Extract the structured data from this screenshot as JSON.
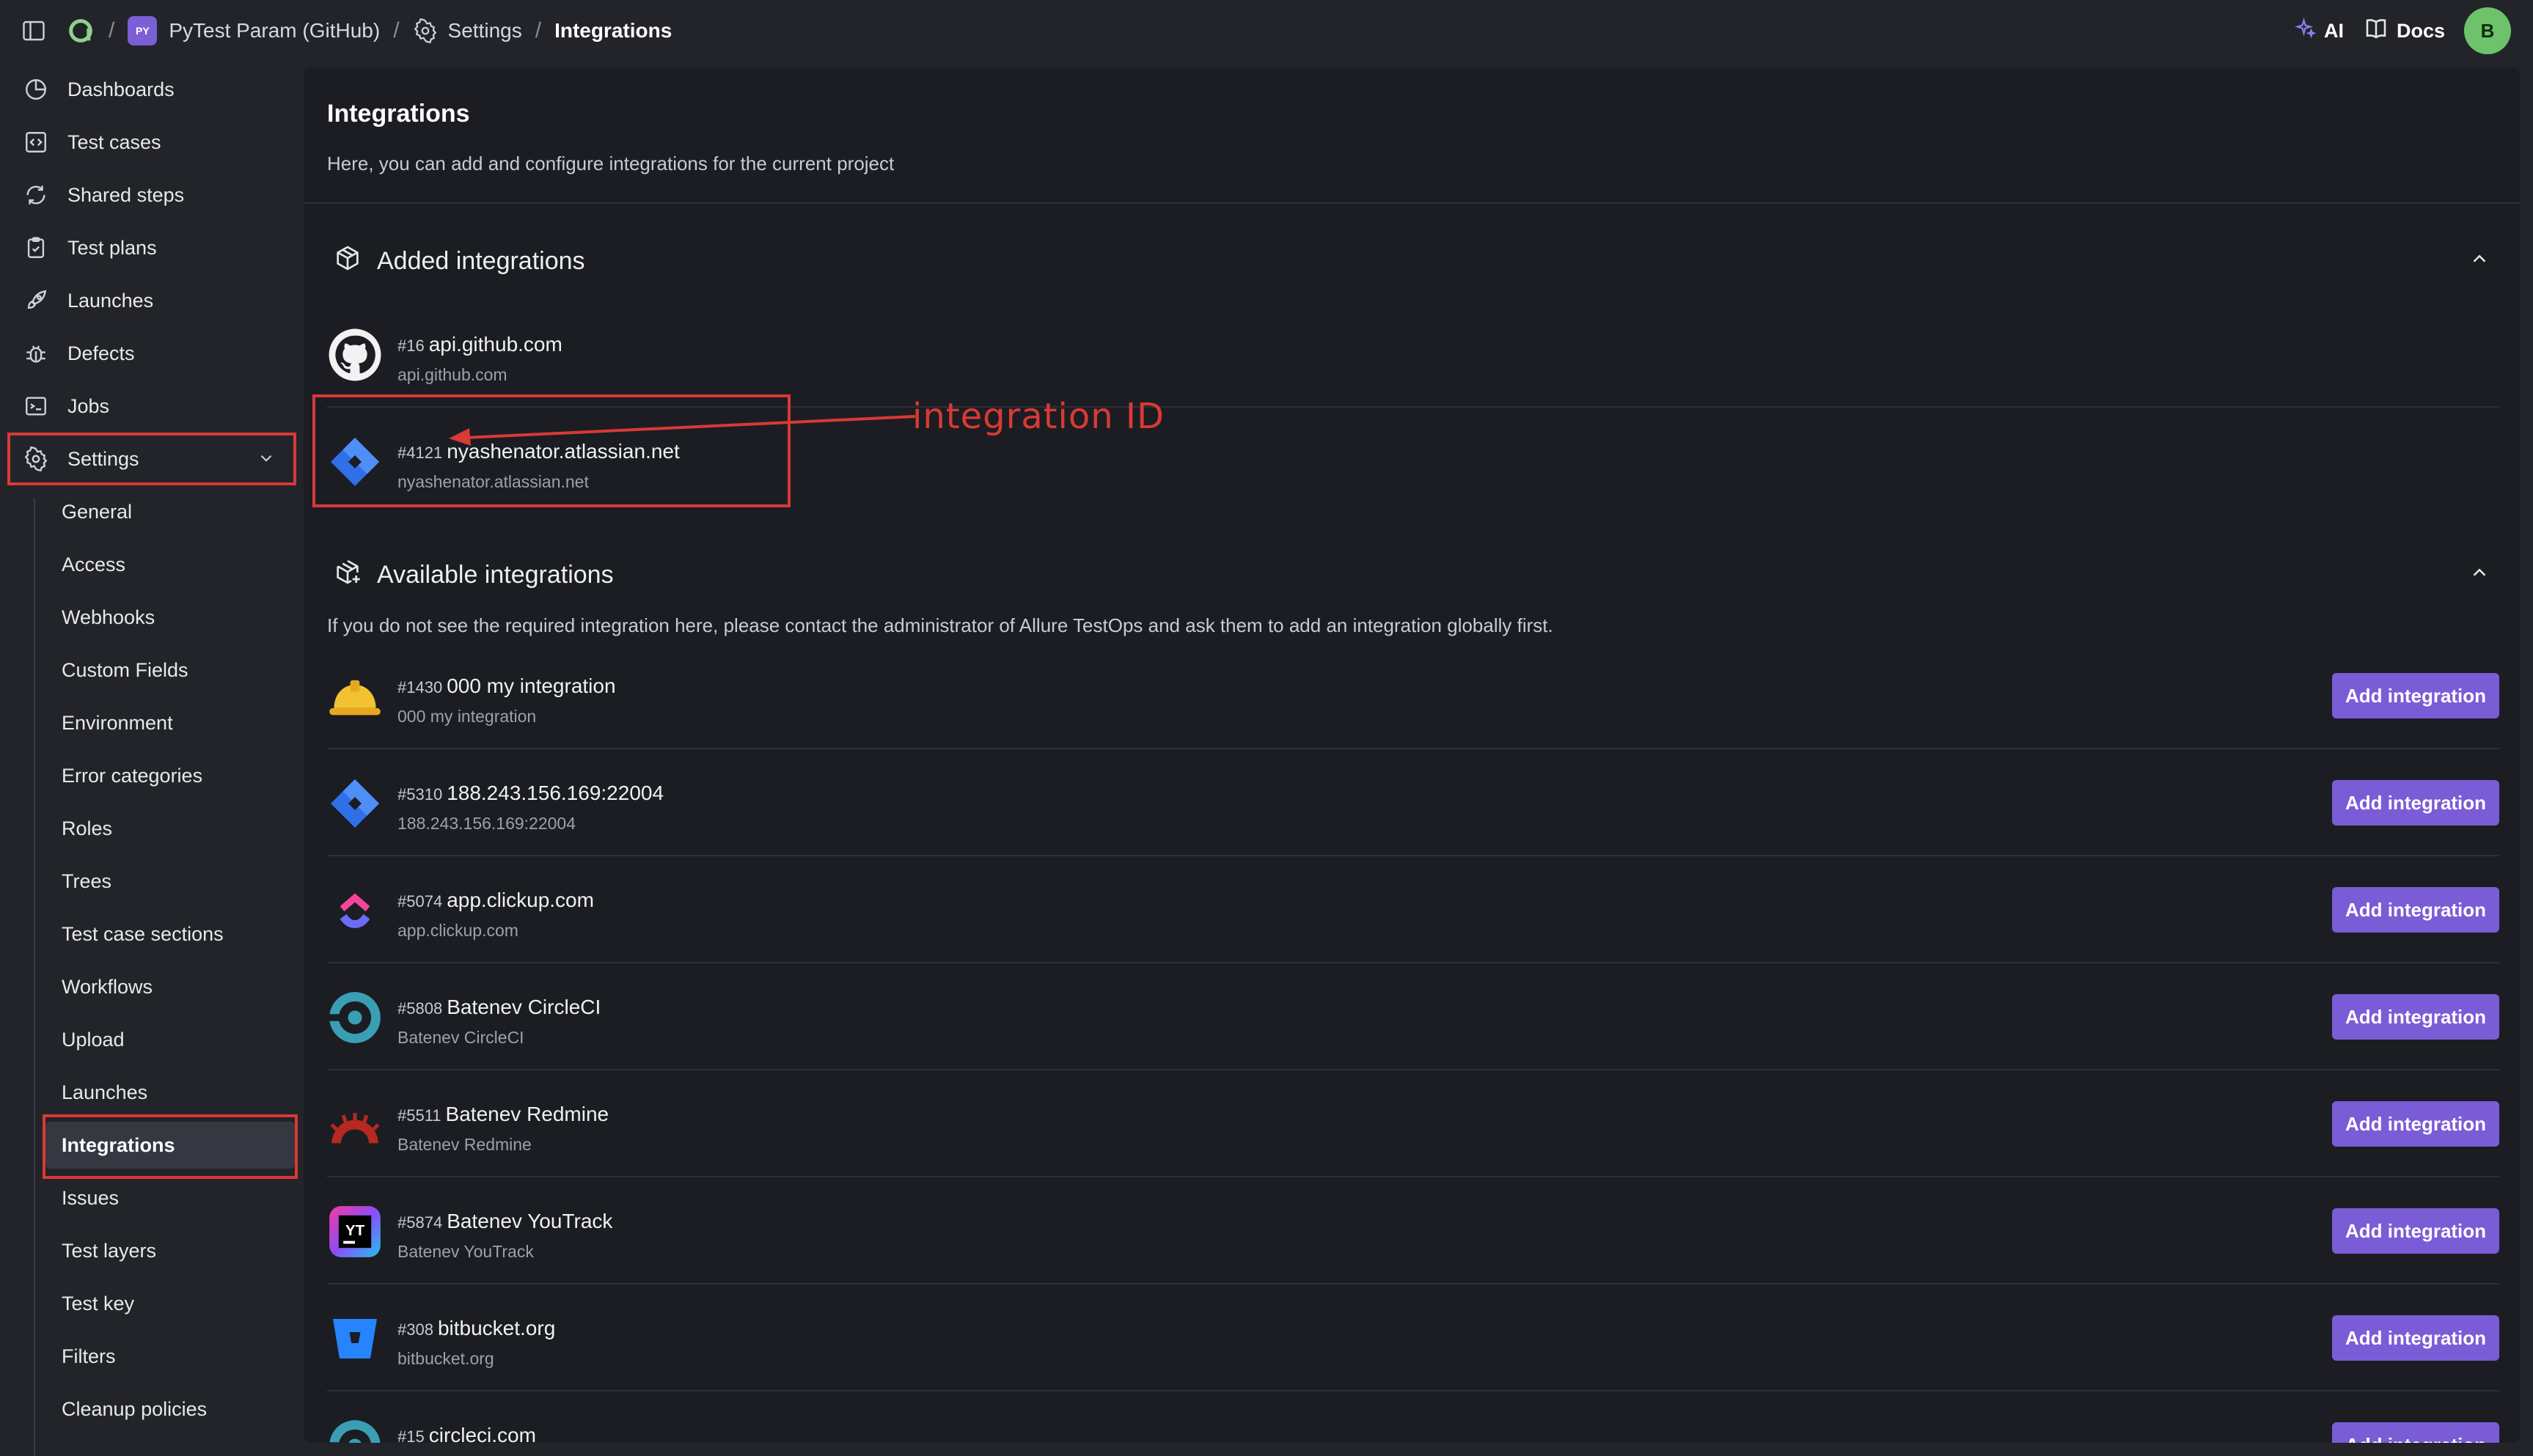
{
  "topbar": {
    "separator": "/",
    "project_badge": "PY",
    "project_name": "PyTest Param (GitHub)",
    "crumb_settings": "Settings",
    "crumb_current": "Integrations",
    "ai_label": "AI",
    "docs_label": "Docs",
    "avatar_initial": "B"
  },
  "sidebar": {
    "items": [
      {
        "label": "Dashboards",
        "icon": "dashboard-icon"
      },
      {
        "label": "Test cases",
        "icon": "code-icon"
      },
      {
        "label": "Shared steps",
        "icon": "refresh-icon"
      },
      {
        "label": "Test plans",
        "icon": "clipboard-icon"
      },
      {
        "label": "Launches",
        "icon": "rocket-icon"
      },
      {
        "label": "Defects",
        "icon": "bug-icon"
      },
      {
        "label": "Jobs",
        "icon": "terminal-icon"
      },
      {
        "label": "Settings",
        "icon": "gear-icon"
      }
    ],
    "settings_sub": [
      "General",
      "Access",
      "Webhooks",
      "Custom Fields",
      "Environment",
      "Error categories",
      "Roles",
      "Trees",
      "Test case sections",
      "Workflows",
      "Upload",
      "Launches",
      "Integrations",
      "Issues",
      "Test layers",
      "Test key",
      "Filters",
      "Cleanup policies"
    ],
    "active_sub": "Integrations"
  },
  "main": {
    "title": "Integrations",
    "description": "Here, you can add and configure integrations for the current project",
    "added": {
      "heading": "Added integrations",
      "items": [
        {
          "id": "#16",
          "name": "api.github.com",
          "sub": "api.github.com",
          "icon": "github-icon"
        },
        {
          "id": "#4121",
          "name": "nyashenator.atlassian.net",
          "sub": "nyashenator.atlassian.net",
          "icon": "jira-icon"
        }
      ]
    },
    "available": {
      "heading": "Available integrations",
      "note": "If you do not see the required integration here, please contact the administrator of Allure TestOps and ask them to add an integration globally first.",
      "button_label": "Add integration",
      "items": [
        {
          "id": "#1430",
          "name": "000 my integration",
          "sub": "000 my integration",
          "icon": "hardhat-icon"
        },
        {
          "id": "#5310",
          "name": "188.243.156.169:22004",
          "sub": "188.243.156.169:22004",
          "icon": "jira-icon"
        },
        {
          "id": "#5074",
          "name": "app.clickup.com",
          "sub": "app.clickup.com",
          "icon": "clickup-icon"
        },
        {
          "id": "#5808",
          "name": "Batenev CircleCI",
          "sub": "Batenev CircleCI",
          "icon": "circleci-icon"
        },
        {
          "id": "#5511",
          "name": "Batenev Redmine",
          "sub": "Batenev Redmine",
          "icon": "redmine-icon"
        },
        {
          "id": "#5874",
          "name": "Batenev YouTrack",
          "sub": "Batenev YouTrack",
          "icon": "youtrack-icon"
        },
        {
          "id": "#308",
          "name": "bitbucket.org",
          "sub": "bitbucket.org",
          "icon": "bitbucket-icon"
        },
        {
          "id": "#15",
          "name": "circleci.com",
          "sub": "",
          "icon": "circleci-icon"
        }
      ]
    }
  },
  "annotation": {
    "label": "integration ID",
    "color": "#d83a35"
  },
  "colors": {
    "accent": "#7a5cd6",
    "background": "#22242a",
    "panel": "#1b1d23"
  }
}
